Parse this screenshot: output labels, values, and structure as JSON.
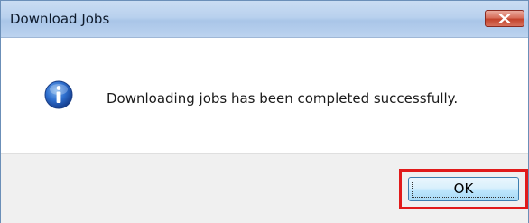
{
  "dialog": {
    "title": "Download Jobs",
    "close_icon": "close-icon",
    "message": "Downloading jobs has been completed successfully.",
    "icon": "information-icon",
    "ok_label": "OK"
  },
  "colors": {
    "highlight": "#e11b1b",
    "close_button": "#c3432c",
    "titlebar": "#b9d1ee"
  }
}
